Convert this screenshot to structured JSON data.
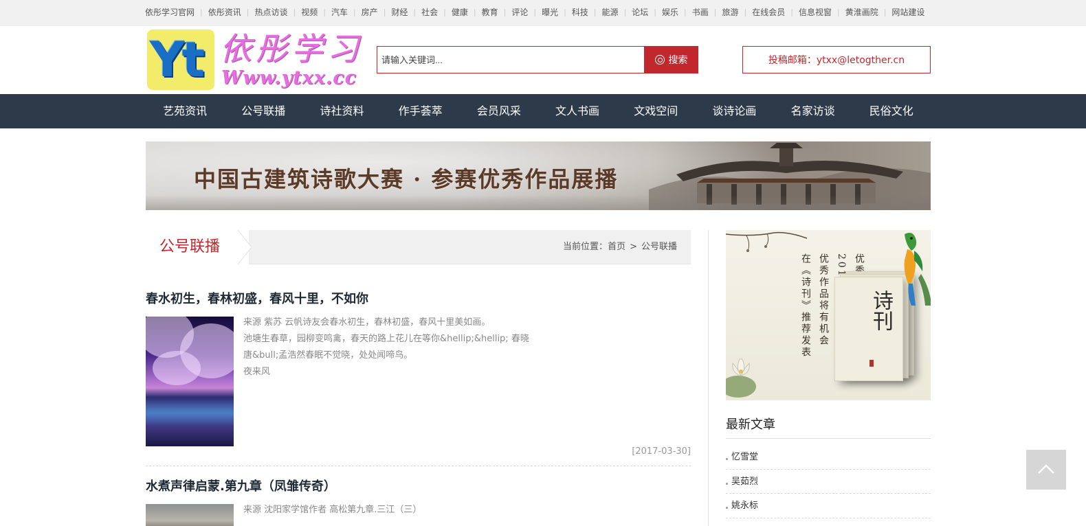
{
  "top_links": [
    "依彤学习官网",
    "依彤资讯",
    "热点访谈",
    "视频",
    "汽车",
    "房产",
    "财经",
    "社会",
    "健康",
    "教育",
    "评论",
    "曝光",
    "科技",
    "能源",
    "论坛",
    "娱乐",
    "书画",
    "旅游",
    "在线会员",
    "信息视窗",
    "黄淮画院",
    "网站建设"
  ],
  "logo": {
    "mark": "Yt",
    "name": "依彤学习",
    "url": "Www.ytxx.cc"
  },
  "search": {
    "placeholder": "请输入关键词...",
    "button_label": "搜索"
  },
  "contact": {
    "text": "投稿邮箱：ytxx@letogther.cn"
  },
  "nav": [
    "艺苑资讯",
    "公号联播",
    "诗社资料",
    "作手荟萃",
    "会员风采",
    "文人书画",
    "文戏空间",
    "谈诗论画",
    "名家访谈",
    "民俗文化"
  ],
  "banner": {
    "title": "中国古建筑诗歌大赛 · 参赛优秀作品展播"
  },
  "section": {
    "title": "公号联播",
    "breadcrumb_prefix": "当前位置：",
    "breadcrumb_home": "首页",
    "breadcrumb_sep": ">",
    "breadcrumb_current": "公号联播"
  },
  "articles": [
    {
      "title": "春水初生，春林初盛，春风十里，不如你",
      "summary_lines": [
        "来源 紫苏 云帆诗友会春水初生，春林初盛，春风十里美如画。",
        "池塘生春草，园柳变鸣禽，春天的路上花儿在等你&hellip;&hellip; 春晓",
        "唐&bull;孟浩然春眠不觉晓，处处闻啼鸟。",
        "夜来风"
      ],
      "date": "[2017-03-30]"
    },
    {
      "title": "水煮声律启蒙.第九章（凤雏传奇）",
      "summary_lines": [
        "来源 沈阳家学馆作者 高松第九章.三江（三）"
      ],
      "date": ""
    }
  ],
  "promo": {
    "columns": [
      "优秀诗人免费申领",
      "2017全年《诗刊》",
      "优秀作品将有机会",
      "在《诗刊》推荐发表"
    ],
    "book_title": "诗刊"
  },
  "sidebar": {
    "title": "最新文章",
    "items": [
      "忆雪堂",
      "吴茹烈",
      "姚永标"
    ]
  },
  "colors": {
    "accent": "#c0282d",
    "nav_bg": "#2c3a4a",
    "topbar_bg": "#f1f1f1"
  },
  "icons": {
    "search": "search-icon",
    "back_to_top": "chevron-up-icon"
  }
}
